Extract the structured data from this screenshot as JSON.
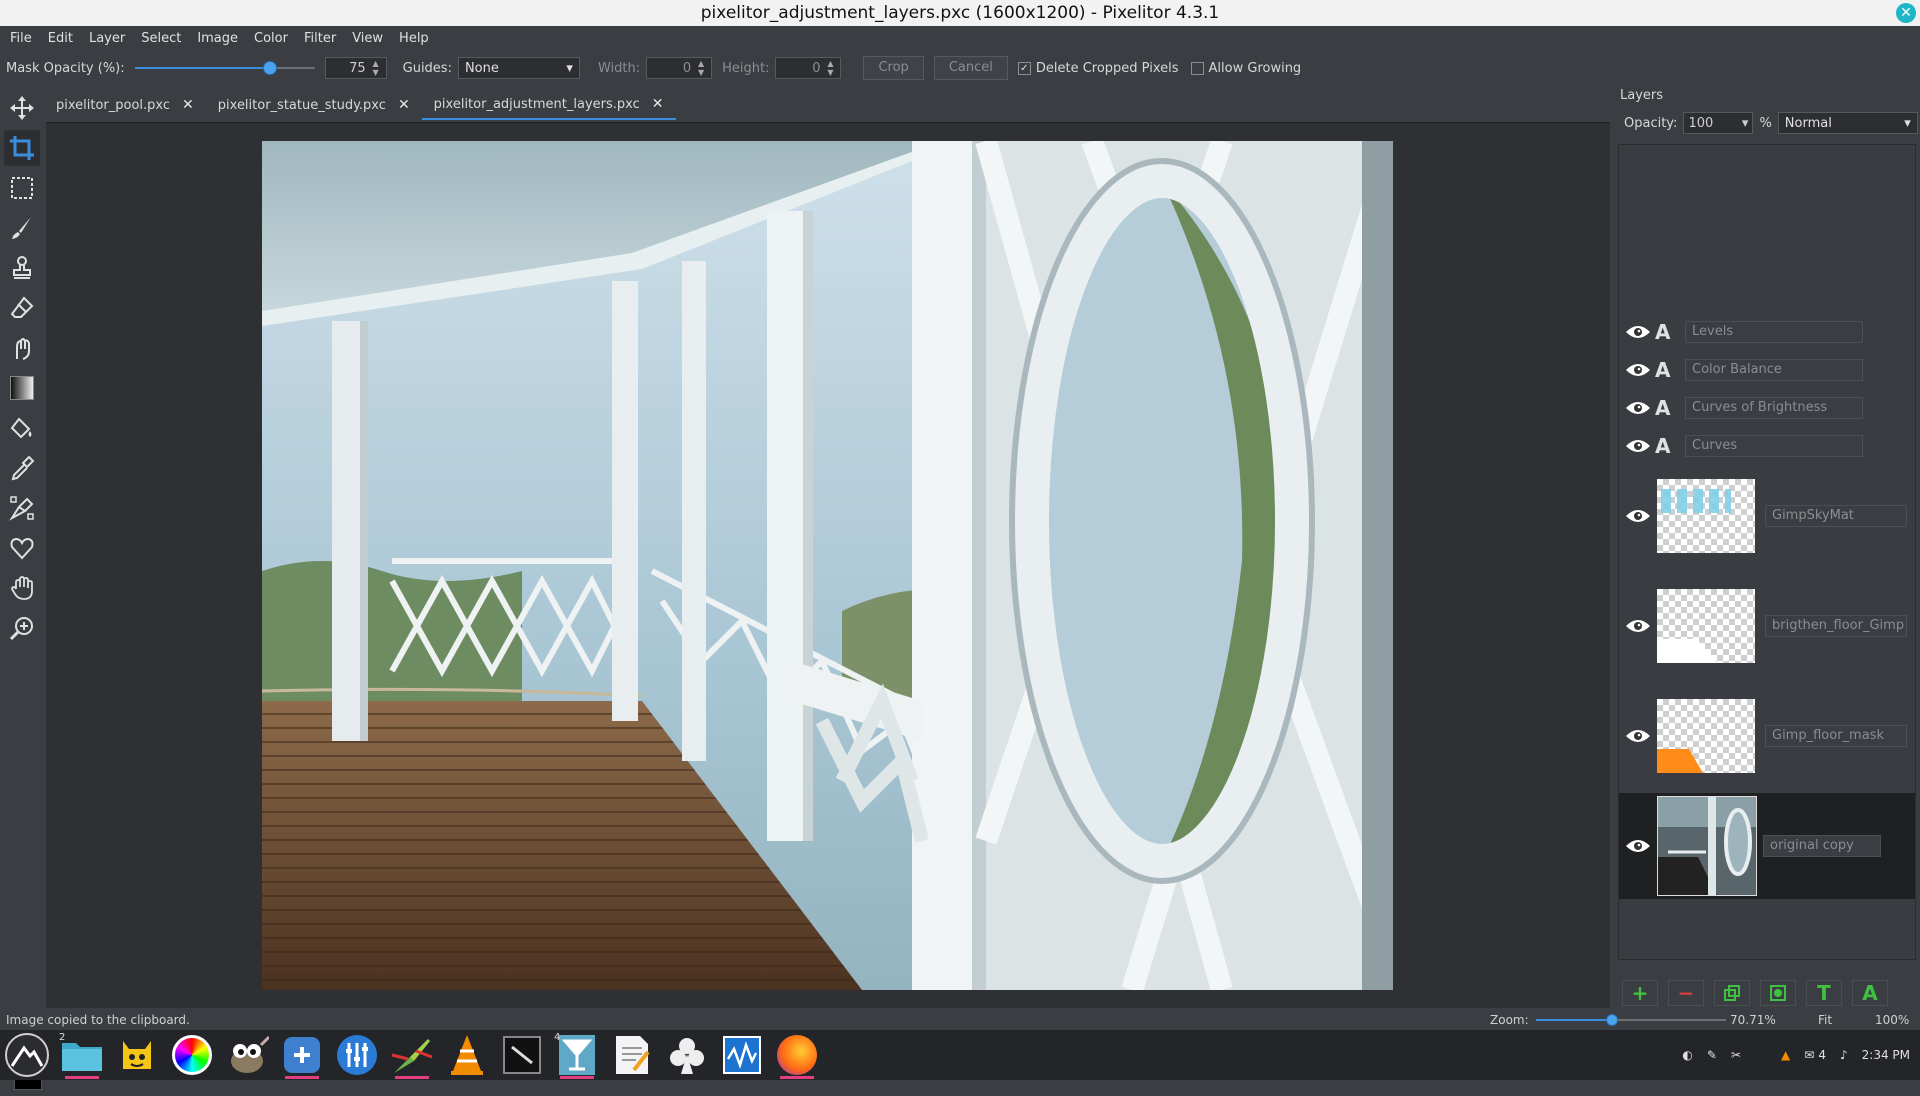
{
  "window": {
    "title": "pixelitor_adjustment_layers.pxc (1600x1200) - Pixelitor 4.3.1"
  },
  "menu": [
    "File",
    "Edit",
    "Layer",
    "Select",
    "Image",
    "Color",
    "Filter",
    "View",
    "Help"
  ],
  "options": {
    "mask_opacity_label": "Mask Opacity (%):",
    "mask_opacity_value": "75",
    "mask_opacity_fraction": 0.75,
    "guides_label": "Guides:",
    "guides_value": "None",
    "width_label": "Width:",
    "width_value": "0",
    "height_label": "Height:",
    "height_value": "0",
    "crop_button": "Crop",
    "cancel_button": "Cancel",
    "delete_cropped_label": "Delete Cropped Pixels",
    "delete_cropped_checked": true,
    "allow_growing_label": "Allow Growing",
    "allow_growing_checked": false
  },
  "tabs": [
    {
      "label": "pixelitor_pool.pxc",
      "active": false
    },
    {
      "label": "pixelitor_statue_study.pxc",
      "active": false
    },
    {
      "label": "pixelitor_adjustment_layers.pxc",
      "active": true
    }
  ],
  "layers_panel": {
    "title": "Layers",
    "opacity_label": "Opacity:",
    "opacity_value": "100",
    "percent": "%",
    "blend_mode": "Normal",
    "adjustment_layers": [
      {
        "name": "Levels"
      },
      {
        "name": "Color Balance"
      },
      {
        "name": "Curves of Brightness"
      },
      {
        "name": "Curves"
      }
    ],
    "image_layers": [
      {
        "name": "GimpSkyMat"
      },
      {
        "name": "brigthen_floor_Gimp"
      },
      {
        "name": "Gimp_floor_mask"
      },
      {
        "name": "original copy",
        "selected": true
      }
    ]
  },
  "status": {
    "message": "Image copied to the clipboard.",
    "zoom_label": "Zoom:",
    "zoom_value": "70.71%",
    "zoom_fraction": 0.4,
    "fit_label": "Fit",
    "hundred_label": "100%"
  },
  "taskbar": {
    "badge_files": "2",
    "badge_cocktail": "4",
    "tray_count": "4",
    "clock": "2:34 PM"
  },
  "colors": {
    "accent": "#3b8de0",
    "add_green": "#40c040",
    "remove_red": "#d04040"
  }
}
